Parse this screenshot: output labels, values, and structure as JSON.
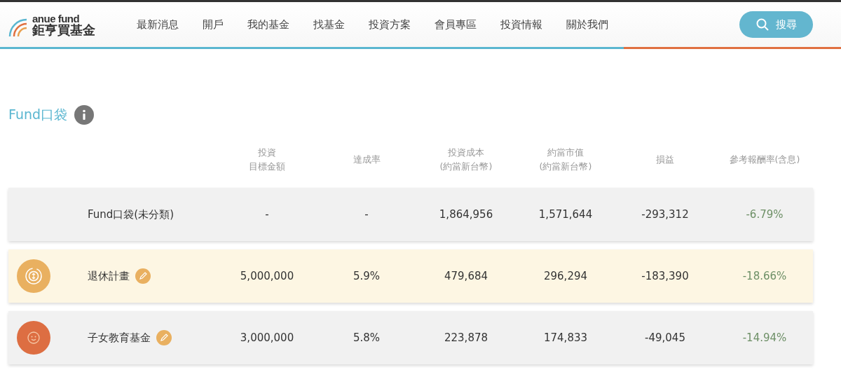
{
  "logo": {
    "brand": "anue fund",
    "name": "鉅亨買基金"
  },
  "nav": [
    "最新消息",
    "開戶",
    "我的基金",
    "找基金",
    "投資方案",
    "會員專區",
    "投資情報",
    "關於我們"
  ],
  "search_button": "搜尋",
  "section": {
    "title": "Fund口袋"
  },
  "columns": [
    [
      "投資",
      "目標金額"
    ],
    [
      "達成率"
    ],
    [
      "投資成本",
      "(約當新台幣)"
    ],
    [
      "約當市值",
      "(約當新台幣)"
    ],
    [
      "損益"
    ],
    [
      "參考報酬率(含息)"
    ]
  ],
  "rows": [
    {
      "kind": "plain",
      "name": "Fund口袋(未分類)",
      "selected": false,
      "editable": false,
      "cells": [
        "-",
        "-",
        "1,864,956",
        "1,571,644",
        "-293,312",
        "-6.79%"
      ]
    },
    {
      "kind": "coin",
      "color": "#e9b060",
      "name": "退休計畫",
      "selected": true,
      "editable": true,
      "cells": [
        "5,000,000",
        "5.9%",
        "479,684",
        "296,294",
        "-183,390",
        "-18.66%"
      ]
    },
    {
      "kind": "baby",
      "color": "#dd6e42",
      "name": "子女教育基金",
      "selected": false,
      "editable": true,
      "cells": [
        "3,000,000",
        "5.8%",
        "223,878",
        "174,833",
        "-49,045",
        "-14.94%"
      ]
    }
  ]
}
